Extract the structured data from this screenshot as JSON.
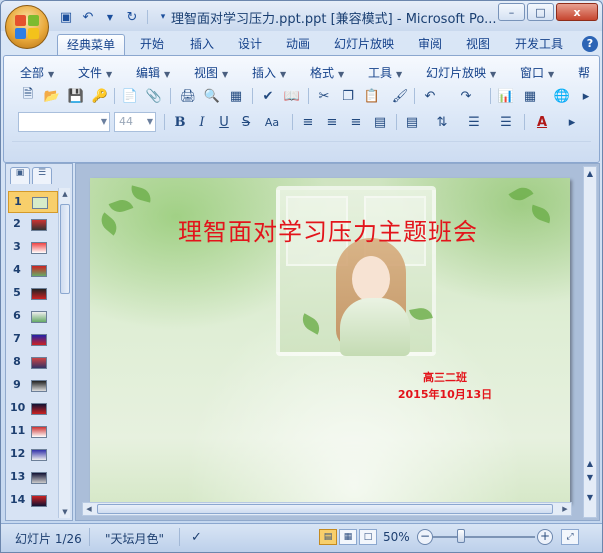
{
  "window": {
    "title": "理智面对学习压力.ppt.ppt [兼容模式] - Microsoft Po...",
    "controls": {
      "minimize": "–",
      "maximize": "□",
      "close": "x"
    }
  },
  "ribbon_tabs": [
    {
      "label": "经典菜单",
      "active": true
    },
    {
      "label": "开始"
    },
    {
      "label": "插入"
    },
    {
      "label": "设计"
    },
    {
      "label": "动画"
    },
    {
      "label": "幻灯片放映"
    },
    {
      "label": "审阅"
    },
    {
      "label": "视图"
    },
    {
      "label": "开发工具"
    }
  ],
  "help_label": "?",
  "menus": [
    "全部",
    "文件",
    "编辑",
    "视图",
    "插入",
    "格式",
    "工具",
    "幻灯片放映",
    "窗口",
    "帮"
  ],
  "font_combo": {
    "font_name": "",
    "font_size": "44"
  },
  "format_buttons": {
    "bold": "B",
    "italic": "I",
    "underline": "U",
    "strike": "S",
    "case": "Aa"
  },
  "slides": {
    "numbers": [
      "1",
      "2",
      "3",
      "4",
      "5",
      "6",
      "7",
      "8",
      "9",
      "10",
      "11",
      "12",
      "13",
      "14"
    ],
    "active": 1
  },
  "slide": {
    "title": "理智面对学习压力主题班会",
    "class_name": "高三二班",
    "date": "2015年10月13日"
  },
  "statusbar": {
    "slide_info": "幻灯片 1/26",
    "theme": "\"天坛月色\"",
    "zoom": "50%",
    "zoom_minus": "−",
    "zoom_plus": "+"
  }
}
